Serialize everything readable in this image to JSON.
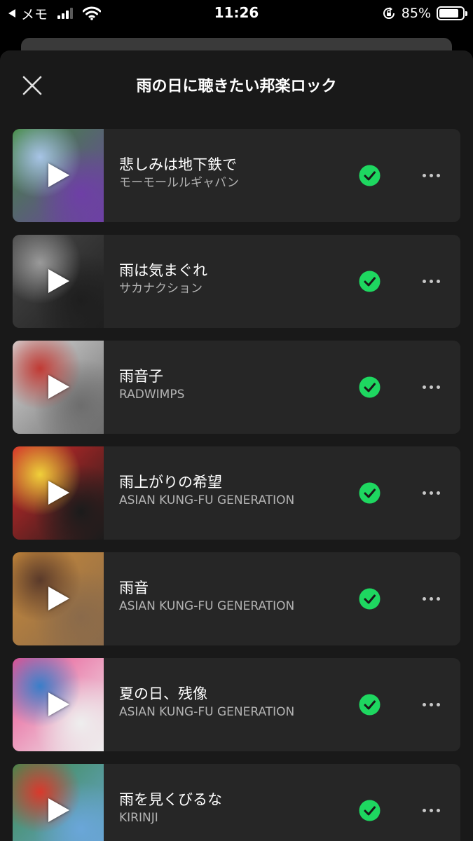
{
  "status_bar": {
    "back_label": "メモ",
    "time": "11:26",
    "battery_percent": "85%",
    "battery_level": 0.85
  },
  "sheet": {
    "title": "雨の日に聴きたい邦楽ロック",
    "icons": {
      "close": "close-icon",
      "play": "play-icon",
      "added": "check-circle-icon",
      "more": "more-dots-icon"
    },
    "colors": {
      "accent": "#1ed760",
      "sheet_bg": "#191919",
      "row_bg": "#262626",
      "subtext": "#b3b3b3"
    },
    "tracks": [
      {
        "title": "悲しみは地下鉄で",
        "artist": "モーモールルギャバン",
        "cover_colors": [
          "#3f8a3a",
          "#a7c4e6",
          "#6e3fa6"
        ]
      },
      {
        "title": "雨は気まぐれ",
        "artist": "サカナクション",
        "cover_colors": [
          "#4a4a4a",
          "#9a9a9a",
          "#1e1e1e"
        ]
      },
      {
        "title": "雨音子",
        "artist": "RADWIMPS",
        "cover_colors": [
          "#d9d9d9",
          "#c13a34",
          "#6d6d6d"
        ]
      },
      {
        "title": "雨上がりの希望",
        "artist": "ASIAN KUNG-FU GENERATION",
        "cover_colors": [
          "#d92a2a",
          "#f0d03a",
          "#1b1b1b"
        ]
      },
      {
        "title": "雨音",
        "artist": "ASIAN KUNG-FU GENERATION",
        "cover_colors": [
          "#c98a3a",
          "#5a3a2a",
          "#8a6a4a"
        ]
      },
      {
        "title": "夏の日、残像",
        "artist": "ASIAN KUNG-FU GENERATION",
        "cover_colors": [
          "#e94c8e",
          "#3a7ec9",
          "#eeeeee"
        ]
      },
      {
        "title": "雨を見くびるな",
        "artist": "KIRINJI",
        "cover_colors": [
          "#3d8a4a",
          "#d9392c",
          "#6aa6d9"
        ]
      }
    ]
  }
}
